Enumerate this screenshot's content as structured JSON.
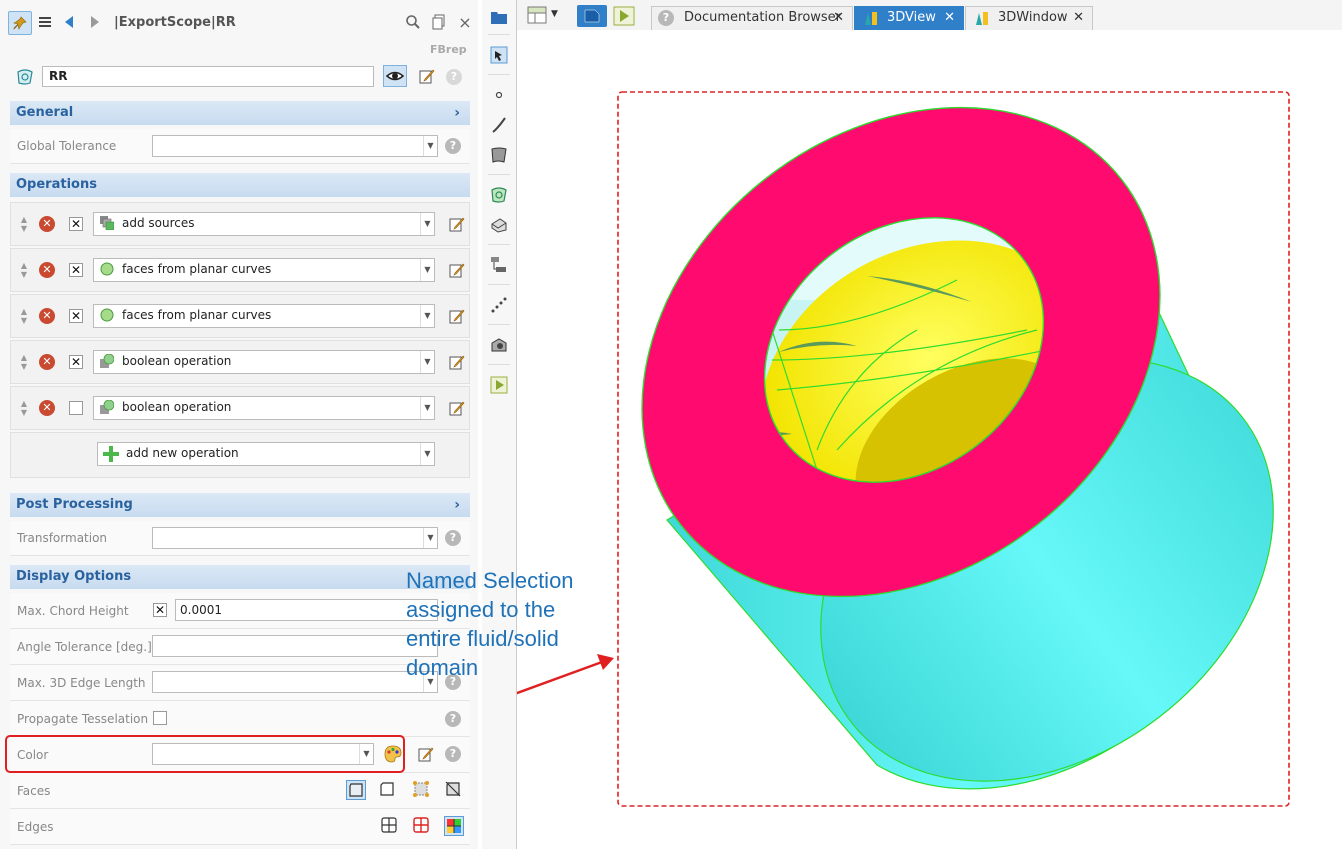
{
  "panel": {
    "title": "|ExportScope|RR",
    "type_label": "FBrep",
    "name_value": "RR"
  },
  "sections": {
    "general": "General",
    "operations": "Operations",
    "post_processing": "Post Processing",
    "display_options": "Display Options"
  },
  "general": {
    "global_tolerance_label": "Global Tolerance",
    "global_tolerance_value": ""
  },
  "operations": {
    "items": [
      {
        "label": "add sources",
        "enabled": true,
        "icon": "sources-icon"
      },
      {
        "label": "faces from planar curves",
        "enabled": true,
        "icon": "green-circle-icon"
      },
      {
        "label": "faces from planar curves",
        "enabled": true,
        "icon": "green-circle-icon"
      },
      {
        "label": "boolean operation",
        "enabled": true,
        "icon": "boolean-icon"
      },
      {
        "label": "boolean operation",
        "enabled": false,
        "icon": "boolean-icon"
      }
    ],
    "add_new_label": "add new operation"
  },
  "post_processing": {
    "transformation_label": "Transformation",
    "transformation_value": ""
  },
  "display_options": {
    "max_chord_height_label": "Max. Chord Height",
    "max_chord_height_value": "0.0001",
    "angle_tolerance_label": "Angle Tolerance [deg.]",
    "max_3d_edge_length_label": "Max. 3D Edge Length",
    "propagate_tesselation_label": "Propagate Tesselation",
    "color_label": "Color",
    "faces_label": "Faces",
    "edges_label": "Edges"
  },
  "tabs": [
    {
      "label": "Documentation Browser",
      "active": false
    },
    {
      "label": "3DView",
      "active": true
    },
    {
      "label": "3DWindow",
      "active": false
    }
  ],
  "annotation": {
    "text": "Named Selection assigned to the entire fluid/solid domain"
  },
  "colors": {
    "accent": "#2f7fc9",
    "section_text": "#2a62a0",
    "ring_face": "#ff0a6e",
    "cylinder": "#5ef4f4",
    "inner_yellow": "#ffff00",
    "annotation_red": "#e02020",
    "edges_green": "#2edb2e"
  }
}
